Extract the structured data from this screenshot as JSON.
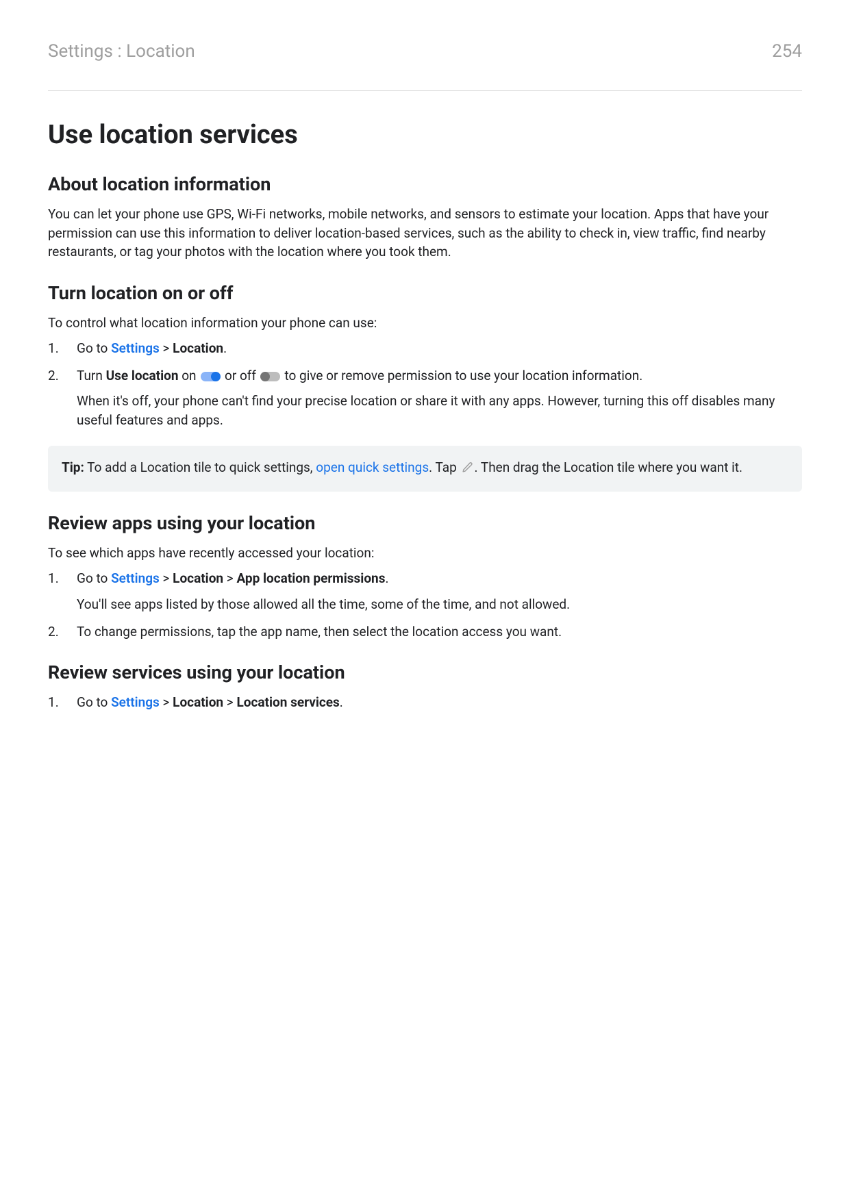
{
  "header": {
    "breadcrumb": "Settings : Location",
    "page_number": "254"
  },
  "title": "Use location services",
  "section_about": {
    "heading": "About location information",
    "body": "You can let your phone use GPS, Wi-Fi networks, mobile networks, and sensors to estimate your location. Apps that have your permission can use this information to deliver location-based services, such as the ability to check in, view traffic, find nearby restaurants, or tag your photos with the location where you took them."
  },
  "section_turn": {
    "heading": "Turn location on or off",
    "intro": "To control what location information your phone can use:",
    "step1_prefix": "Go to ",
    "step1_link": "Settings",
    "step1_sep": " > ",
    "step1_bold": "Location",
    "step1_suffix": ".",
    "step2_prefix": "Turn ",
    "step2_bold": "Use location",
    "step2_on": " on ",
    "step2_or": " or off ",
    "step2_suffix": " to give or remove permission to use your location information.",
    "step2_note": "When it's off, your phone can't find your precise location or share it with any apps. However, turning this off disables many useful features and apps.",
    "tip_label": "Tip:",
    "tip_p1": " To add a Location tile to quick settings, ",
    "tip_link": "open quick settings",
    "tip_p2": ". Tap ",
    "tip_p3": ". Then drag the Location tile where you want it."
  },
  "section_review_apps": {
    "heading": "Review apps using your location",
    "intro": "To see which apps have recently accessed your location:",
    "step1_prefix": "Go to ",
    "step1_link": "Settings",
    "step1_sep1": " > ",
    "step1_b1": "Location",
    "step1_sep2": " > ",
    "step1_b2": "App location permissions",
    "step1_suffix": ".",
    "step1_note": "You'll see apps listed by those allowed all the time, some of the time, and not allowed.",
    "step2": "To change permissions, tap the app name, then select the location access you want."
  },
  "section_review_services": {
    "heading": "Review services using your location",
    "step1_prefix": "Go to ",
    "step1_link": "Settings",
    "step1_sep1": " > ",
    "step1_b1": "Location",
    "step1_sep2": " > ",
    "step1_b2": "Location services",
    "step1_suffix": "."
  }
}
